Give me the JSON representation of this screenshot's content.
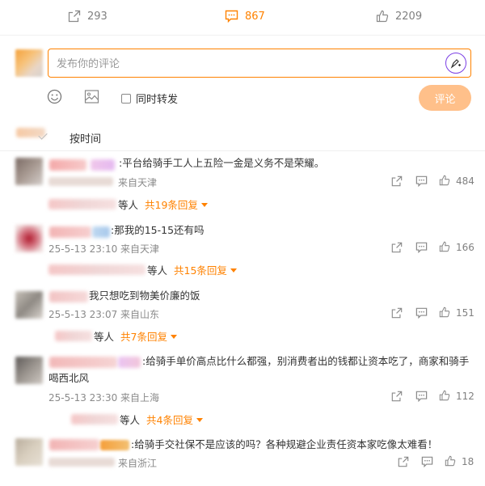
{
  "action_bar": {
    "repost_count": "293",
    "comment_count": "867",
    "like_count": "2209"
  },
  "composer": {
    "placeholder": "发布你的评论",
    "repost_label": "同时转发",
    "submit_label": "评论"
  },
  "sort": {
    "label": "按时间"
  },
  "comments": [
    {
      "text": ":平台给骑手工人上五险一金是义务不是荣耀。",
      "meta": "来自天津",
      "likes": "484",
      "reply_who": "等人",
      "reply_label": "共19条回复"
    },
    {
      "text": ":那我的15-15还有吗",
      "meta": "25-5-13 23:10 来自天津",
      "likes": "166",
      "reply_who": "等人",
      "reply_label": "共15条回复"
    },
    {
      "text": "我只想吃到物美价廉的饭",
      "meta": "25-5-13 23:07 来自山东",
      "likes": "151",
      "reply_who": "等人",
      "reply_label": "共7条回复"
    },
    {
      "text_line1": ":给骑手单价高点比什么都强，别消费者出的钱都让资本吃了，商家和骑手",
      "text_line2": "喝西北风",
      "meta": "25-5-13 23:30 来自上海",
      "likes": "112",
      "reply_who": "等人",
      "reply_label": "共4条回复"
    },
    {
      "text": ":给骑手交社保不是应该的吗？各种规避企业责任资本家吃像太难看！",
      "meta": "来自浙江",
      "likes": "18"
    }
  ],
  "colors": {
    "accent": "#ff8200",
    "muted": "#808080",
    "submit_bg": "#ffc08a",
    "pen_ring": "#7b3fe4"
  }
}
